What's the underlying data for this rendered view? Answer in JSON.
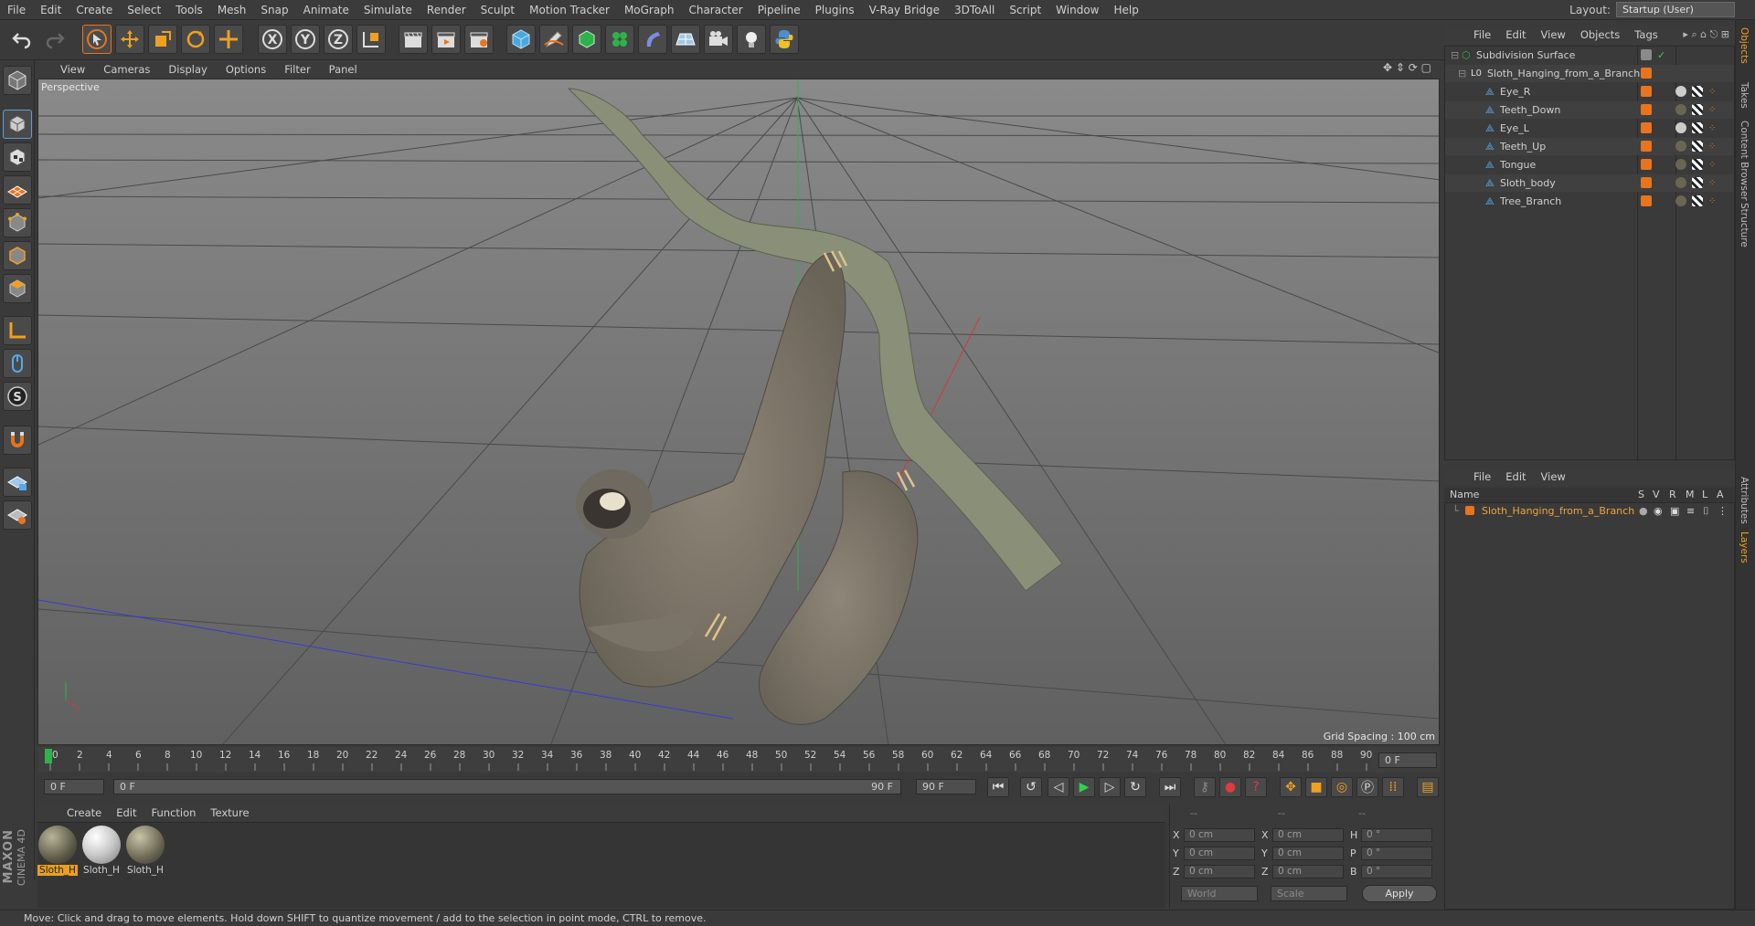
{
  "menubar": {
    "items": [
      "File",
      "Edit",
      "Create",
      "Select",
      "Tools",
      "Mesh",
      "Snap",
      "Animate",
      "Simulate",
      "Render",
      "Sculpt",
      "Motion Tracker",
      "MoGraph",
      "Character",
      "Pipeline",
      "Plugins",
      "V-Ray Bridge",
      "3DToAll",
      "Script",
      "Window",
      "Help"
    ],
    "layout_label": "Layout:",
    "layout_value": "Startup (User)"
  },
  "viewport": {
    "menu": [
      "View",
      "Cameras",
      "Display",
      "Options",
      "Filter",
      "Panel"
    ],
    "label": "Perspective",
    "grid_spacing": "Grid Spacing : 100 cm"
  },
  "timeline": {
    "ticks": [
      "0",
      "2",
      "4",
      "6",
      "8",
      "10",
      "12",
      "14",
      "16",
      "18",
      "20",
      "22",
      "24",
      "26",
      "28",
      "30",
      "32",
      "34",
      "36",
      "38",
      "40",
      "42",
      "44",
      "46",
      "48",
      "50",
      "52",
      "54",
      "56",
      "58",
      "60",
      "62",
      "64",
      "66",
      "68",
      "70",
      "72",
      "74",
      "76",
      "78",
      "80",
      "82",
      "84",
      "86",
      "88",
      "90"
    ],
    "current_frame": "0 F"
  },
  "transport": {
    "start_field": "0 F",
    "range_start": "0 F",
    "range_end": "90 F",
    "end_field": "90 F"
  },
  "materials": {
    "menu": [
      "Create",
      "Edit",
      "Function",
      "Texture"
    ],
    "items": [
      {
        "label": "Sloth_H",
        "selected": true
      },
      {
        "label": "Sloth_H",
        "selected": false
      },
      {
        "label": "Sloth_H",
        "selected": false
      }
    ]
  },
  "coords": {
    "header_a": "--",
    "header_b": "--",
    "header_c": "--",
    "rows": [
      {
        "l1": "X",
        "v1": "0 cm",
        "l2": "X",
        "v2": "0 cm",
        "l3": "H",
        "v3": "0 °"
      },
      {
        "l1": "Y",
        "v1": "0 cm",
        "l2": "Y",
        "v2": "0 cm",
        "l3": "P",
        "v3": "0 °"
      },
      {
        "l1": "Z",
        "v1": "0 cm",
        "l2": "Z",
        "v2": "0 cm",
        "l3": "B",
        "v3": "0 °"
      }
    ],
    "space": "World",
    "mode": "Scale",
    "apply": "Apply"
  },
  "status": {
    "text": "Move: Click and drag to move elements. Hold down SHIFT to quantize movement / add to the selection in point mode, CTRL to remove."
  },
  "objects": {
    "menu": [
      "File",
      "Edit",
      "View",
      "Objects",
      "Tags"
    ],
    "rows": [
      {
        "name": "Subdivision Surface",
        "indent": 0
      },
      {
        "name": "Sloth_Hanging_from_a_Branch",
        "indent": 1
      },
      {
        "name": "Eye_R",
        "indent": 2
      },
      {
        "name": "Teeth_Down",
        "indent": 2
      },
      {
        "name": "Eye_L",
        "indent": 2
      },
      {
        "name": "Teeth_Up",
        "indent": 2
      },
      {
        "name": "Tongue",
        "indent": 2
      },
      {
        "name": "Sloth_body",
        "indent": 2
      },
      {
        "name": "Tree_Branch",
        "indent": 2
      }
    ]
  },
  "layers": {
    "menu": [
      "File",
      "Edit",
      "View"
    ],
    "header": {
      "name": "Name",
      "cols": [
        "S",
        "V",
        "R",
        "M",
        "L",
        "A"
      ]
    },
    "rows": [
      {
        "name": "Sloth_Hanging_from_a_Branch"
      }
    ]
  },
  "sidetabs": [
    "Objects",
    "Takes",
    "Content Browser",
    "Structure",
    "Attributes",
    "Layers"
  ],
  "branding": {
    "line1": "MAXON",
    "line2": "CINEMA 4D"
  },
  "colors": {
    "accent": "#e8741e",
    "highlight": "#f0a020",
    "selected_label": "#f2a33a"
  }
}
